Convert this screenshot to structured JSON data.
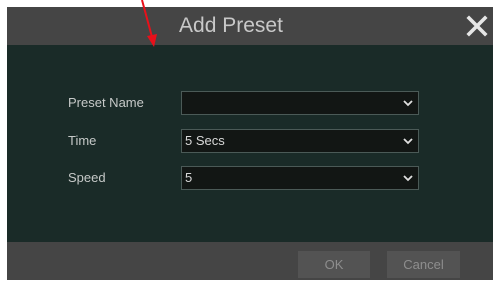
{
  "dialog": {
    "title": "Add Preset",
    "close_icon": "close-icon"
  },
  "form": {
    "fields": [
      {
        "label": "Preset Name",
        "value": ""
      },
      {
        "label": "Time",
        "value": "5 Secs"
      },
      {
        "label": "Speed",
        "value": "5"
      }
    ]
  },
  "footer": {
    "ok_label": "OK",
    "cancel_label": "Cancel"
  },
  "colors": {
    "annotation_arrow": "#e8101a",
    "titlebar": "#454545",
    "body": "#1a2b28"
  }
}
